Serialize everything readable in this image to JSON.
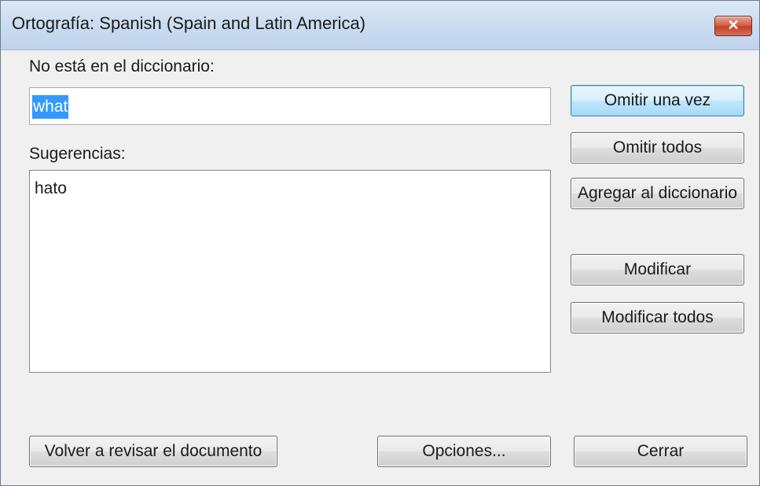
{
  "window": {
    "title": "Ortografía: Spanish (Spain and Latin America)",
    "close_label": "✕"
  },
  "not_in_dictionary": {
    "label": "No está en el diccionario:",
    "value": "what"
  },
  "suggestions": {
    "label": "Sugerencias:",
    "items": [
      "hato"
    ]
  },
  "buttons": {
    "ignore_once": "Omitir una vez",
    "ignore_all": "Omitir todos",
    "add_to_dictionary": "Agregar al diccionario",
    "change": "Modificar",
    "change_all": "Modificar todos",
    "recheck_document": "Volver a revisar el documento",
    "options": "Opciones...",
    "close": "Cerrar"
  },
  "colors": {
    "selection": "#3399ff",
    "close_button": "#c9503a",
    "titlebar": "#c9dbef"
  }
}
